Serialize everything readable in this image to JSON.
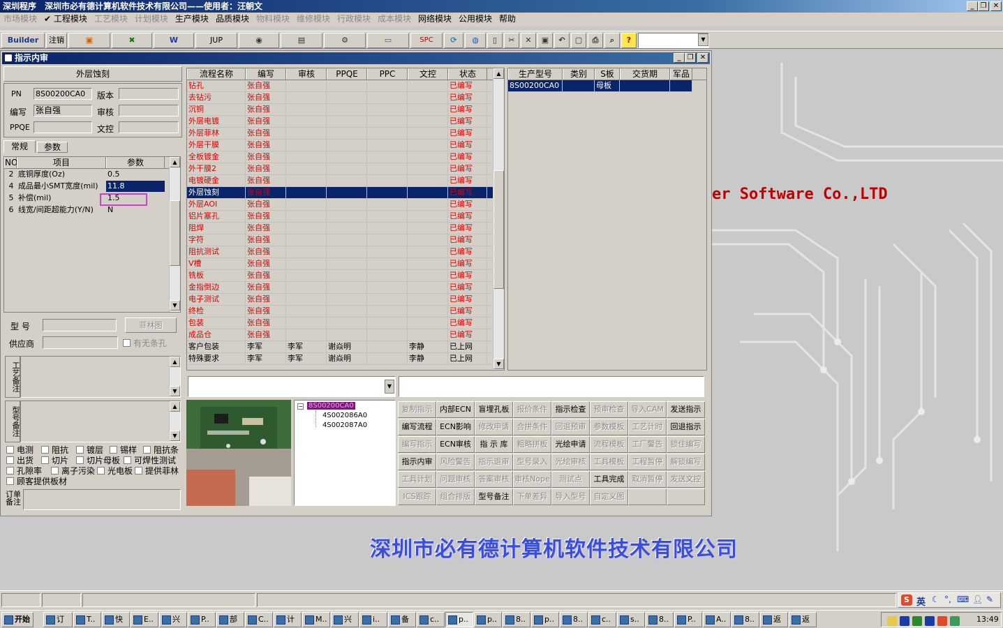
{
  "app": {
    "title": "深圳程序",
    "company": "深圳市必有德计算机软件技术有限公司——使用者：汪朝文"
  },
  "menu": [
    {
      "label": "市场模块",
      "enabled": false
    },
    {
      "label": "✔ 工程模块",
      "enabled": true
    },
    {
      "label": "工艺模块",
      "enabled": false
    },
    {
      "label": "计划模块",
      "enabled": false
    },
    {
      "label": "生产模块",
      "enabled": true
    },
    {
      "label": "品质模块",
      "enabled": true
    },
    {
      "label": "物料模块",
      "enabled": false
    },
    {
      "label": "维修模块",
      "enabled": false
    },
    {
      "label": "行政模块",
      "enabled": false
    },
    {
      "label": "成本模块",
      "enabled": false
    },
    {
      "label": "网络模块",
      "enabled": true
    },
    {
      "label": "公用模块",
      "enabled": true
    },
    {
      "label": "帮助",
      "enabled": true
    }
  ],
  "toolbar": {
    "builder": "Builder",
    "logout": "注销",
    "jup": "JUP",
    "spc": "SPC",
    "help": "?"
  },
  "window": {
    "title": "指示内审"
  },
  "left": {
    "heading": "外层蚀刻",
    "pn_label": "PN",
    "pn_value": "8S00200CA0",
    "version_label": "版本",
    "version_value": "",
    "author_label": "编写",
    "author_value": "张自强",
    "review_label": "审核",
    "review_value": "",
    "ppqe_label": "PPQE",
    "ppqe_value": "",
    "doc_label": "文控",
    "doc_value": "",
    "tabs": [
      "常规",
      "参数"
    ],
    "param_headers": [
      "NO",
      "项目",
      "参数"
    ],
    "params": [
      {
        "no": "2",
        "item": "底铜厚度(Oz)",
        "value": "0.5"
      },
      {
        "no": "4",
        "item": "成品最小SMT宽度(mil)",
        "value": "11.8"
      },
      {
        "no": "5",
        "item": "补偿(mil)",
        "value": "1.5"
      },
      {
        "no": "6",
        "item": "线宽/间距超能力(Y/N)",
        "value": "N"
      }
    ],
    "model_label": "型  号",
    "feilin_button": "菲林图",
    "supplier_label": "供应商",
    "no_hole_label": "有无条孔",
    "craft_note_label": "工艺备注",
    "model_note_label": "型号备注",
    "order_note_label": "订单备注",
    "checks": [
      [
        "电测",
        "阻抗",
        "镀层",
        "锡样",
        "阻抗条"
      ],
      [
        "出货",
        "切片",
        "切片母板",
        "可焊性测试"
      ],
      [
        "孔隙率",
        "离子污染",
        "光电板",
        "提供菲林"
      ],
      [
        "顾客提供板材"
      ]
    ]
  },
  "flow": {
    "headers": [
      "流程名称",
      "编写",
      "审核",
      "PPQE",
      "PPC",
      "文控",
      "状态"
    ],
    "rows": [
      {
        "name": "钻孔",
        "author": "张自强",
        "review": "",
        "ppqe": "",
        "ppc": "",
        "doc": "",
        "status": "已编写"
      },
      {
        "name": "去钻污",
        "author": "张自强",
        "review": "",
        "ppqe": "",
        "ppc": "",
        "doc": "",
        "status": "已编写"
      },
      {
        "name": "沉铜",
        "author": "张自强",
        "review": "",
        "ppqe": "",
        "ppc": "",
        "doc": "",
        "status": "已编写"
      },
      {
        "name": "外层电镀",
        "author": "张自强",
        "review": "",
        "ppqe": "",
        "ppc": "",
        "doc": "",
        "status": "已编写"
      },
      {
        "name": "外层菲林",
        "author": "张自强",
        "review": "",
        "ppqe": "",
        "ppc": "",
        "doc": "",
        "status": "已编写"
      },
      {
        "name": "外层干膜",
        "author": "张自强",
        "review": "",
        "ppqe": "",
        "ppc": "",
        "doc": "",
        "status": "已编写"
      },
      {
        "name": "全板镀金",
        "author": "张自强",
        "review": "",
        "ppqe": "",
        "ppc": "",
        "doc": "",
        "status": "已编写"
      },
      {
        "name": "外干膜2",
        "author": "张自强",
        "review": "",
        "ppqe": "",
        "ppc": "",
        "doc": "",
        "status": "已编写"
      },
      {
        "name": "电镀硬金",
        "author": "张自强",
        "review": "",
        "ppqe": "",
        "ppc": "",
        "doc": "",
        "status": "已编写"
      },
      {
        "name": "外层蚀刻",
        "author": "张自强",
        "review": "",
        "ppqe": "",
        "ppc": "",
        "doc": "",
        "status": "已编写"
      },
      {
        "name": "外层AOI",
        "author": "张自强",
        "review": "",
        "ppqe": "",
        "ppc": "",
        "doc": "",
        "status": "已编写"
      },
      {
        "name": "铝片塞孔",
        "author": "张自强",
        "review": "",
        "ppqe": "",
        "ppc": "",
        "doc": "",
        "status": "已编写"
      },
      {
        "name": "阻焊",
        "author": "张自强",
        "review": "",
        "ppqe": "",
        "ppc": "",
        "doc": "",
        "status": "已编写"
      },
      {
        "name": "字符",
        "author": "张自强",
        "review": "",
        "ppqe": "",
        "ppc": "",
        "doc": "",
        "status": "已编写"
      },
      {
        "name": "阻抗测试",
        "author": "张自强",
        "review": "",
        "ppqe": "",
        "ppc": "",
        "doc": "",
        "status": "已编写"
      },
      {
        "name": "V槽",
        "author": "张自强",
        "review": "",
        "ppqe": "",
        "ppc": "",
        "doc": "",
        "status": "已编写"
      },
      {
        "name": "铣板",
        "author": "张自强",
        "review": "",
        "ppqe": "",
        "ppc": "",
        "doc": "",
        "status": "已编写"
      },
      {
        "name": "金指倒边",
        "author": "张自强",
        "review": "",
        "ppqe": "",
        "ppc": "",
        "doc": "",
        "status": "已编写"
      },
      {
        "name": "电子测试",
        "author": "张自强",
        "review": "",
        "ppqe": "",
        "ppc": "",
        "doc": "",
        "status": "已编写"
      },
      {
        "name": "终检",
        "author": "张自强",
        "review": "",
        "ppqe": "",
        "ppc": "",
        "doc": "",
        "status": "已编写"
      },
      {
        "name": "包装",
        "author": "张自强",
        "review": "",
        "ppqe": "",
        "ppc": "",
        "doc": "",
        "status": "已编写"
      },
      {
        "name": "成品仓",
        "author": "张自强",
        "review": "",
        "ppqe": "",
        "ppc": "",
        "doc": "",
        "status": "已编写"
      },
      {
        "name": "客户包装",
        "author": "李军",
        "review": "李军",
        "ppqe": "谢焱明",
        "ppc": "",
        "doc": "李静",
        "status": "已上网"
      },
      {
        "name": "特殊要求",
        "author": "李军",
        "review": "李军",
        "ppqe": "谢焱明",
        "ppc": "",
        "doc": "李静",
        "status": "已上网"
      }
    ]
  },
  "production": {
    "headers": [
      "生产型号",
      "类别",
      "S板",
      "交货期",
      "军品"
    ],
    "rows": [
      {
        "model": "8S00200CA0",
        "category": "",
        "s_board": "母板",
        "delivery": "",
        "military": ""
      }
    ]
  },
  "tree": {
    "root": "8S00200CA0",
    "children": [
      "4S002086A0",
      "4S002087A0"
    ]
  },
  "buttons": [
    [
      {
        "l": "复制指示",
        "e": false
      },
      {
        "l": "内部ECN",
        "e": true
      },
      {
        "l": "盲埋孔板",
        "e": true
      },
      {
        "l": "报价条件",
        "e": false
      },
      {
        "l": "指示检查",
        "e": true
      },
      {
        "l": "预审检查",
        "e": false
      },
      {
        "l": "导入CAM",
        "e": false
      },
      {
        "l": "发送指示",
        "e": true
      }
    ],
    [
      {
        "l": "编写流程",
        "e": true
      },
      {
        "l": "ECN影响",
        "e": true
      },
      {
        "l": "修改申请",
        "e": false
      },
      {
        "l": "合拼条件",
        "e": false
      },
      {
        "l": "回退预审",
        "e": false
      },
      {
        "l": "参数模板",
        "e": false
      },
      {
        "l": "工艺计时",
        "e": false
      },
      {
        "l": "回退指示",
        "e": true
      }
    ],
    [
      {
        "l": "编写指示",
        "e": false
      },
      {
        "l": "ECN审核",
        "e": true
      },
      {
        "l": "指 示 库",
        "e": true
      },
      {
        "l": "粗略拼板",
        "e": false
      },
      {
        "l": "光绘申请",
        "e": true
      },
      {
        "l": "流程模板",
        "e": false
      },
      {
        "l": "工厂警告",
        "e": false
      },
      {
        "l": "锁住编写",
        "e": false
      }
    ],
    [
      {
        "l": "指示内审",
        "e": true
      },
      {
        "l": "风险警告",
        "e": false
      },
      {
        "l": "指示退审",
        "e": false
      },
      {
        "l": "型号录入",
        "e": false
      },
      {
        "l": "光绘审核",
        "e": false
      },
      {
        "l": "工具模板",
        "e": false
      },
      {
        "l": "工程暂停",
        "e": false
      },
      {
        "l": "解锁编写",
        "e": false
      }
    ],
    [
      {
        "l": "工具计划",
        "e": false
      },
      {
        "l": "问题审核",
        "e": false
      },
      {
        "l": "答案审核",
        "e": false
      },
      {
        "l": "审核Nope",
        "e": false
      },
      {
        "l": "测试点",
        "e": false
      },
      {
        "l": "工具完成",
        "e": true
      },
      {
        "l": "取消暂停",
        "e": false
      },
      {
        "l": "发送文控",
        "e": false
      }
    ],
    [
      {
        "l": "ICS跟踪",
        "e": false
      },
      {
        "l": "组合排版",
        "e": false
      },
      {
        "l": "型号备注",
        "e": true
      },
      {
        "l": "下单差异",
        "e": false
      },
      {
        "l": "导入型号",
        "e": false
      },
      {
        "l": "自定义图",
        "e": false
      },
      {
        "l": "",
        "e": false
      },
      {
        "l": "",
        "e": false
      }
    ]
  ],
  "desktop": {
    "slogan": "er Software Co.,LTD",
    "company": "深圳市必有德计算机软件技术有限公司"
  },
  "taskbar": {
    "start": "开始",
    "items": [
      "订",
      "T..",
      "快",
      "E..",
      "兴",
      "P..",
      "部",
      "C..",
      "计",
      "M..",
      "兴",
      "i..",
      "备",
      "c..",
      "p..",
      "p..",
      "8..",
      "p..",
      "8..",
      "c..",
      "s..",
      "8..",
      "P..",
      "A..",
      "8..",
      "返",
      "返"
    ],
    "clock": "13:49",
    "ime": "英"
  }
}
